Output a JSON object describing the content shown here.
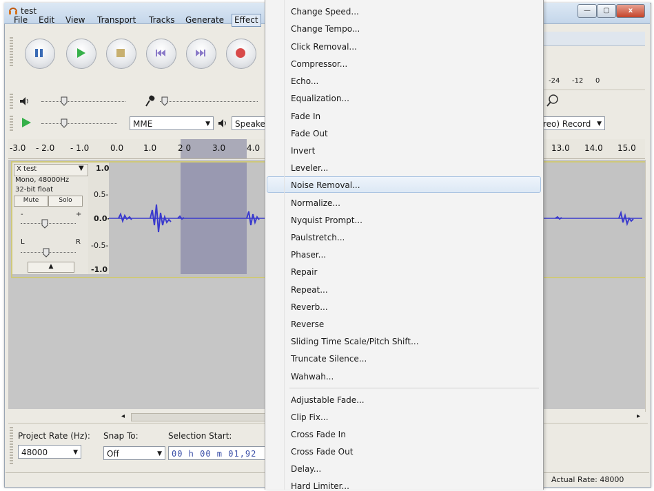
{
  "window": {
    "title": "test",
    "min": "—",
    "max": "▢",
    "close": "x"
  },
  "menubar": [
    "File",
    "Edit",
    "View",
    "Transport",
    "Tracks",
    "Generate",
    "Effect"
  ],
  "meter": {
    "labels": [
      "-24",
      "-12",
      "0"
    ]
  },
  "device": {
    "host": "MME",
    "output": "Speake",
    "record_channels": "reo) Record"
  },
  "ruler": {
    "left_ticks": [
      "-3.0",
      "- 2.0",
      "- 1.0",
      "0.0",
      "1.0",
      "2 0",
      "3.0",
      "4.0"
    ],
    "right_ticks": [
      "13.0",
      "14.0",
      "15.0"
    ]
  },
  "track": {
    "name": "test",
    "close": "X",
    "info1": "Mono, 48000Hz",
    "info2": "32-bit float",
    "mute": "Mute",
    "solo": "Solo",
    "gain_minus": "-",
    "gain_plus": "+",
    "pan_left": "L",
    "pan_right": "R",
    "collapse": "▲",
    "scale": [
      "1.0",
      "0.5-",
      "0.0-",
      "-0.5-",
      "-1.0"
    ]
  },
  "bottom": {
    "project_rate_label": "Project Rate (Hz):",
    "project_rate_value": "48000",
    "snap_label": "Snap To:",
    "snap_value": "Off",
    "selection_label": "Selection Start:",
    "selection_value": "00 h 00 m 01,92"
  },
  "status": {
    "actual_rate": "Actual Rate: 48000"
  },
  "effect_menu": {
    "items": [
      "Change Speed...",
      "Change Tempo...",
      "Click Removal...",
      "Compressor...",
      "Echo...",
      "Equalization...",
      "Fade In",
      "Fade Out",
      "Invert",
      "Leveler...",
      "Noise Removal...",
      "Normalize...",
      "Nyquist Prompt...",
      "Paulstretch...",
      "Phaser...",
      "Repair",
      "Repeat...",
      "Reverb...",
      "Reverse",
      "Sliding Time Scale/Pitch Shift...",
      "Truncate Silence...",
      "Wahwah..."
    ],
    "items2": [
      "Adjustable Fade...",
      "Clip Fix...",
      "Cross Fade In",
      "Cross Fade Out",
      "Delay...",
      "Hard Limiter..."
    ],
    "highlighted": "Noise Removal..."
  }
}
